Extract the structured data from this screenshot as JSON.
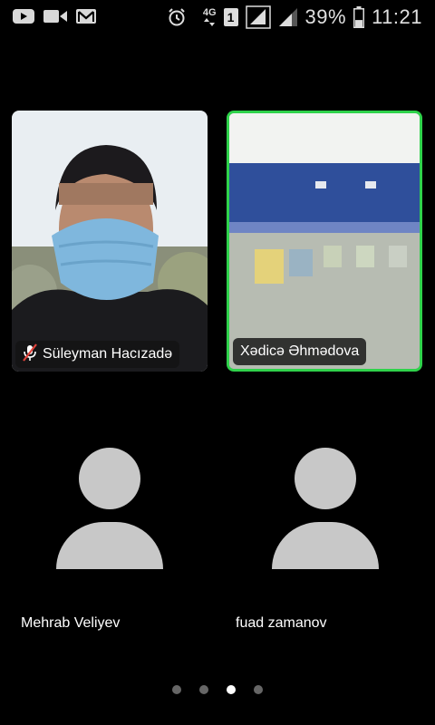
{
  "status_bar": {
    "left_icons": [
      "youtube-icon",
      "video-camera-icon",
      "gmail-icon"
    ],
    "alarm_icon": "alarm-clock-icon",
    "network_type": "4G",
    "sim_slot": "1",
    "battery_percent": "39%",
    "battery_level": 0.39,
    "time": "11:21"
  },
  "video_tiles": [
    {
      "name": "Süleyman Hacızadə",
      "muted": true,
      "active_speaker": false
    },
    {
      "name": "Xədicə Əhmədova",
      "muted": false,
      "active_speaker": true
    }
  ],
  "avatar_tiles": [
    {
      "name": "Mehrab Veliyev"
    },
    {
      "name": "fuad zamanov"
    }
  ],
  "pagination": {
    "total": 4,
    "active_index": 2
  },
  "colors": {
    "active_speaker_border": "#2fd24b",
    "muted_mic": "#e0433b",
    "avatar_gray": "#c8c8c8"
  }
}
